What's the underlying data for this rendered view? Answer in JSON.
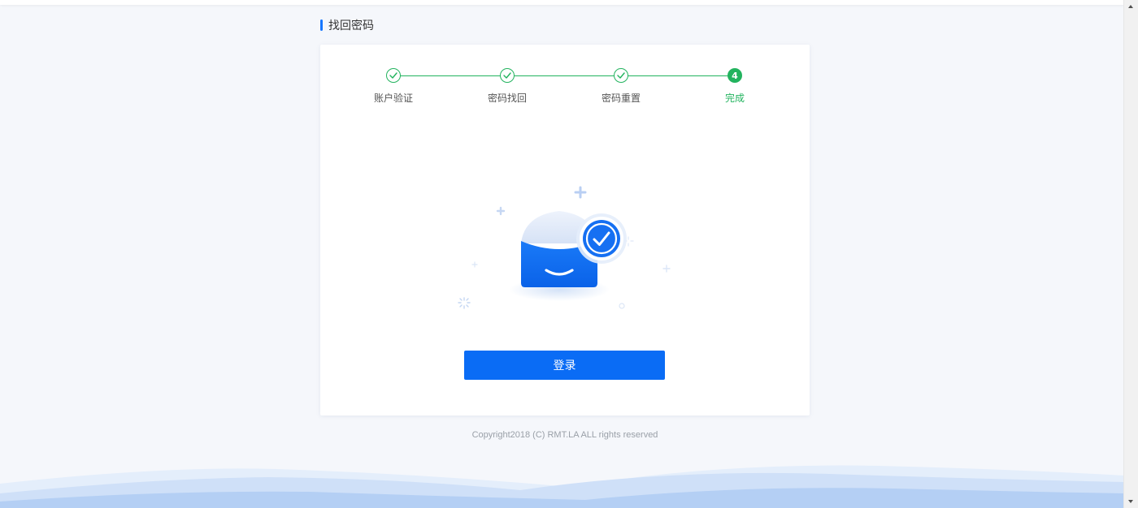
{
  "page": {
    "title": "找回密码",
    "accent_color": "#1677ff"
  },
  "steps": {
    "color": "#22b35e",
    "items": [
      {
        "label": "账户验证",
        "status": "done",
        "icon": "check-icon"
      },
      {
        "label": "密码找回",
        "status": "done",
        "icon": "check-icon"
      },
      {
        "label": "密码重置",
        "status": "done",
        "icon": "check-icon"
      },
      {
        "label": "完成",
        "status": "current",
        "number": "4"
      }
    ]
  },
  "result": {
    "icon": "mail-success-icon",
    "login_label": "登录",
    "button_color": "#0a6cf5"
  },
  "footer": {
    "copyright": "Copyright2018 (C) RMT.LA ALL rights reserved"
  }
}
